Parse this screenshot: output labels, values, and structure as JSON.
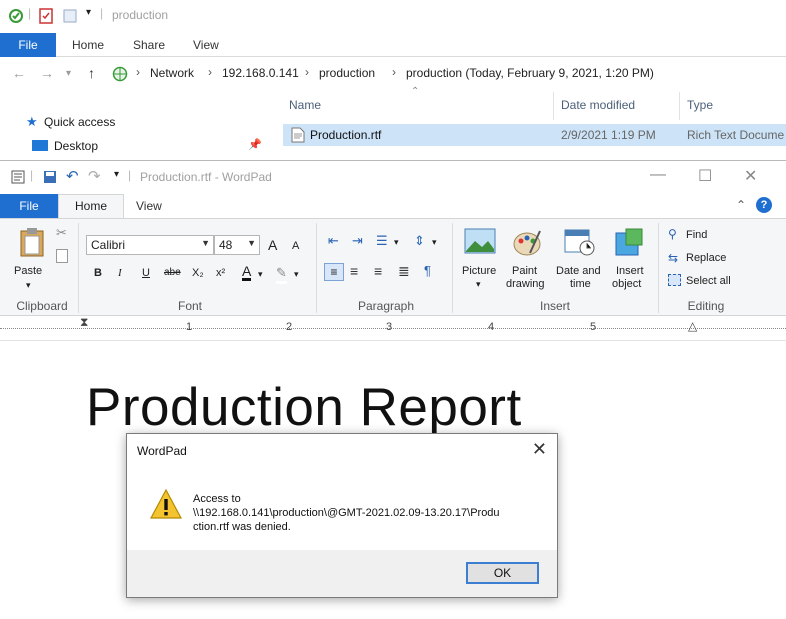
{
  "explorer": {
    "title": "production",
    "tabs": [
      "File",
      "Home",
      "Share",
      "View"
    ],
    "breadcrumb": [
      "Network",
      "192.168.0.141",
      "production",
      "production (Today, February 9, 2021, 1:20 PM)"
    ],
    "nav": {
      "quick_access": "Quick access",
      "desktop": "Desktop"
    },
    "columns": {
      "name": "Name",
      "date": "Date modified",
      "type": "Type"
    },
    "file": {
      "name": "Production.rtf",
      "date": "2/9/2021 1:19 PM",
      "type": "Rich Text Docume"
    }
  },
  "wordpad": {
    "title": "Production.rtf - WordPad",
    "tabs": {
      "file": "File",
      "home": "Home",
      "view": "View"
    },
    "clipboard": {
      "paste": "Paste",
      "label": "Clipboard"
    },
    "font": {
      "family": "Calibri",
      "size": "48",
      "label": "Font",
      "bold": "B",
      "italic": "I",
      "underline": "U",
      "strike": "abe",
      "sub": "X₂",
      "sup": "x²",
      "grow": "A",
      "shrink": "A"
    },
    "paragraph": {
      "label": "Paragraph"
    },
    "insert": {
      "picture": "Picture",
      "paint1": "Paint",
      "paint2": "drawing",
      "date1": "Date and",
      "date2": "time",
      "obj1": "Insert",
      "obj2": "object",
      "label": "Insert"
    },
    "editing": {
      "find": "Find",
      "replace": "Replace",
      "select_all": "Select all",
      "label": "Editing"
    },
    "ruler": [
      "1",
      "2",
      "3",
      "4",
      "5"
    ],
    "document": {
      "heading": "Production Report"
    }
  },
  "dialog": {
    "title": "WordPad",
    "message_line1": "Access to",
    "message_line2": "\\\\192.168.0.141\\production\\@GMT-2021.02.09-13.20.17\\Produ",
    "message_line3": "ction.rtf was denied.",
    "ok": "OK"
  },
  "colors": {
    "accent": "#1f6fd0",
    "selection": "#cde3f7",
    "warning": "#f4c430"
  }
}
